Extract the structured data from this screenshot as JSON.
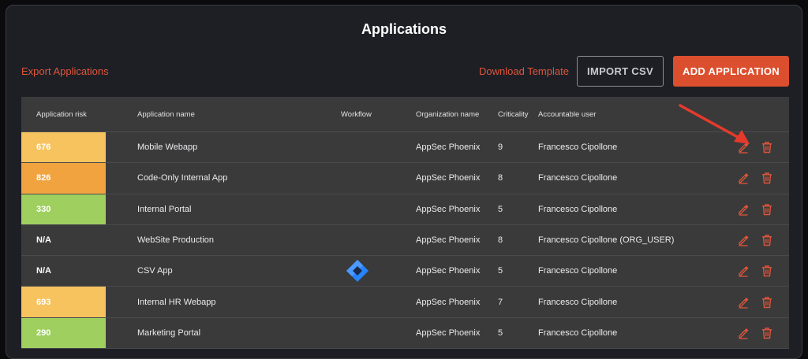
{
  "page": {
    "title": "Applications"
  },
  "toolbar": {
    "export_label": "Export Applications",
    "download_label": "Download Template",
    "import_label": "IMPORT CSV",
    "add_label": "ADD APPLICATION"
  },
  "table": {
    "headers": {
      "risk": "Application risk",
      "name": "Application name",
      "workflow": "Workflow",
      "org": "Organization name",
      "criticality": "Criticality",
      "user": "Accountable user"
    },
    "rows": [
      {
        "risk": "676",
        "name": "Mobile Webapp",
        "org": "AppSec Phoenix",
        "criticality": "9",
        "user": "Francesco Cipollone",
        "risk_color": "#f6c35f",
        "workflow": ""
      },
      {
        "risk": "826",
        "name": "Code-Only Internal App",
        "org": "AppSec Phoenix",
        "criticality": "8",
        "user": "Francesco Cipollone",
        "risk_color": "#f0a33e",
        "workflow": ""
      },
      {
        "risk": "330",
        "name": "Internal Portal",
        "org": "AppSec Phoenix",
        "criticality": "5",
        "user": "Francesco Cipollone",
        "risk_color": "#9fcf5f",
        "workflow": ""
      },
      {
        "risk": "N/A",
        "name": "WebSite Production",
        "org": "AppSec Phoenix",
        "criticality": "8",
        "user": "Francesco Cipollone (ORG_USER)",
        "risk_color": "",
        "workflow": ""
      },
      {
        "risk": "N/A",
        "name": "CSV App",
        "org": "AppSec Phoenix",
        "criticality": "5",
        "user": "Francesco Cipollone",
        "risk_color": "",
        "workflow": "jira-icon"
      },
      {
        "risk": "693",
        "name": "Internal HR Webapp",
        "org": "AppSec Phoenix",
        "criticality": "7",
        "user": "Francesco Cipollone",
        "risk_color": "#f6c35f",
        "workflow": ""
      },
      {
        "risk": "290",
        "name": "Marketing Portal",
        "org": "AppSec Phoenix",
        "criticality": "5",
        "user": "Francesco Cipollone",
        "risk_color": "#9fcf5f",
        "workflow": ""
      }
    ]
  },
  "colors": {
    "accent": "#dc4f2e",
    "link": "#e0553a",
    "annotation_arrow": "#e53a2b"
  },
  "icons": {
    "edit": "pencil-icon",
    "delete": "trash-icon",
    "workflow": "jira-icon"
  }
}
